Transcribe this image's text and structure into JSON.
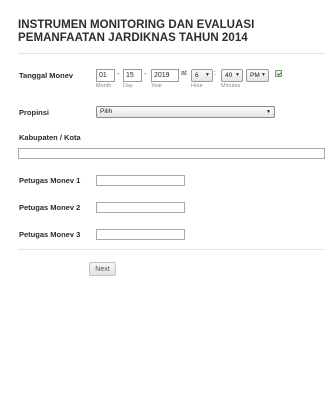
{
  "form": {
    "title": "INSTRUMEN MONITORING DAN EVALUASI PEMANFAATAN JARDIKNAS TAHUN 2014"
  },
  "tanggal": {
    "label": "Tanggal Monev",
    "month_value": "01",
    "day_value": "15",
    "year_value": "2019",
    "month_sublabel": "Month",
    "day_sublabel": "Day",
    "year_sublabel": "Year",
    "date_separator": "-",
    "at_label": "at",
    "hour_value": "6",
    "hour_sublabel": "Hour",
    "time_separator": ":",
    "minute_value": "40",
    "minute_sublabel": "Minutes",
    "ampm_value": "PM",
    "calendar_icon": "calendar-check-icon"
  },
  "propinsi": {
    "label": "Propinsi",
    "selected": "Pilih"
  },
  "kabupaten": {
    "label": "Kabupaten / Kota",
    "value": ""
  },
  "petugas": [
    {
      "label": "Petugas Monev 1",
      "value": ""
    },
    {
      "label": "Petugas Monev 2",
      "value": ""
    },
    {
      "label": "Petugas Monev 3",
      "value": ""
    }
  ],
  "buttons": {
    "next": "Next"
  },
  "icons": {
    "dropdown_arrow": "chevron-down-icon"
  },
  "colors": {
    "text": "#2b2b2b",
    "divider": "#e3e3e3",
    "input_border": "#a9a9a9"
  }
}
